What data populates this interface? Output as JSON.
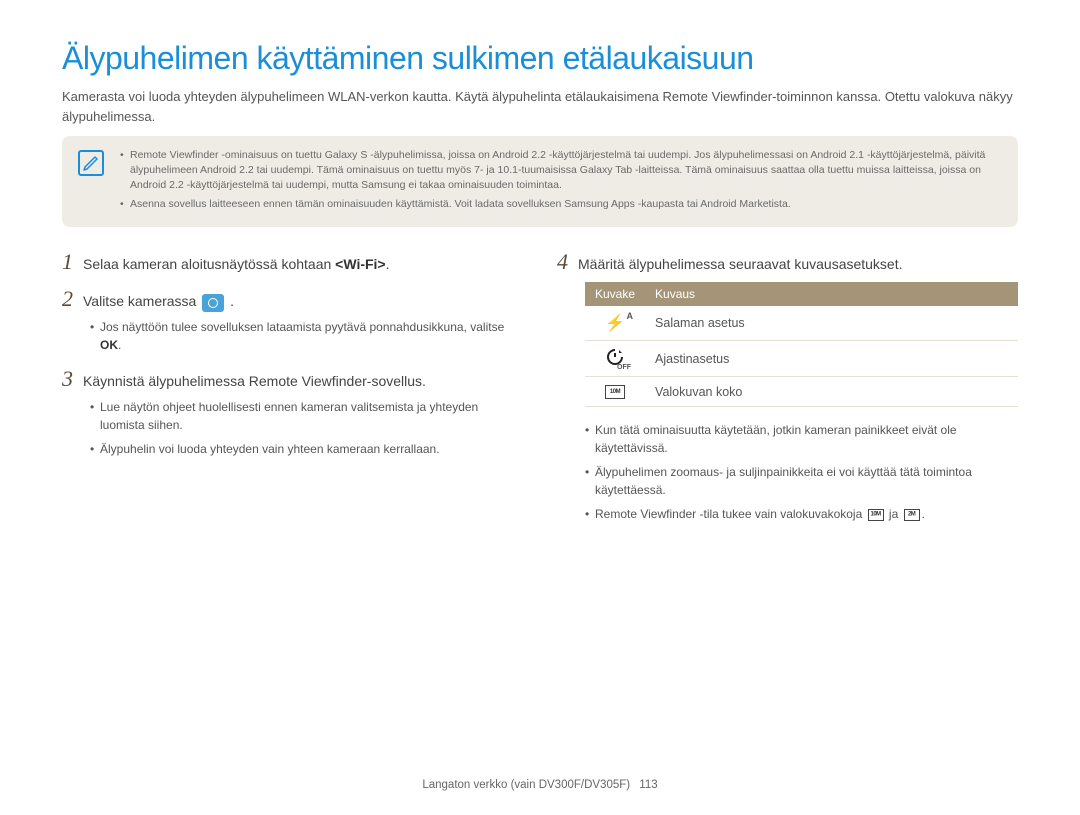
{
  "title": "Älypuhelimen käyttäminen sulkimen etälaukaisuun",
  "intro": "Kamerasta voi luoda yhteyden älypuhelimeen WLAN-verkon kautta. Käytä älypuhelinta etälaukaisimena Remote Viewfinder-toiminnon kanssa. Otettu valokuva näkyy älypuhelimessa.",
  "notes": [
    "Remote Viewfinder -ominaisuus on tuettu Galaxy S -älypuhelimissa, joissa on Android 2.2 -käyttöjärjestelmä tai uudempi. Jos älypuhelimessasi on Android 2.1 -käyttöjärjestelmä, päivitä älypuhelimeen Android 2.2 tai uudempi. Tämä ominaisuus on tuettu myös 7- ja 10.1-tuumaisissa Galaxy Tab -laitteissa. Tämä ominaisuus saattaa olla tuettu muissa laitteissa, joissa on Android 2.2 -käyttöjärjestelmä tai uudempi, mutta Samsung ei takaa ominaisuuden toimintaa.",
    "Asenna sovellus laitteeseen ennen tämän ominaisuuden käyttämistä. Voit ladata sovelluksen Samsung Apps -kaupasta tai Android Marketista."
  ],
  "left": {
    "step1_pre": "Selaa kameran aloitusnäytössä kohtaan ",
    "step1_b": "<Wi-Fi>",
    "step1_post": ".",
    "step2_pre": "Valitse kamerassa ",
    "step2_post": " .",
    "step2_b1": "Jos näyttöön tulee sovelluksen lataamista pyytävä ponnahdusikkuna, valitse ",
    "step2_b1_b": "OK",
    "step2_b1_post": ".",
    "step3": "Käynnistä älypuhelimessa Remote Viewfinder-sovellus.",
    "step3_b1": "Lue näytön ohjeet huolellisesti ennen kameran valitsemista ja yhteyden luomista siihen.",
    "step3_b2": "Älypuhelin voi luoda yhteyden vain yhteen kameraan kerrallaan."
  },
  "right": {
    "step4": "Määritä älypuhelimessa seuraavat kuvausasetukset.",
    "table": {
      "head": [
        "Kuvake",
        "Kuvaus"
      ],
      "rows": [
        {
          "icon": "flash",
          "label": "Salaman asetus"
        },
        {
          "icon": "timer",
          "label": "Ajastinasetus"
        },
        {
          "icon": "size",
          "label": "Valokuvan koko"
        }
      ]
    },
    "b1": "Kun tätä ominaisuutta käytetään, jotkin kameran painikkeet eivät ole käytettävissä.",
    "b2": "Älypuhelimen zoomaus- ja suljinpainikkeita ei voi käyttää tätä toimintoa käytettäessä.",
    "b3_pre": "Remote Viewfinder -tila tukee vain valokuvakokoja ",
    "b3_mid": " ja ",
    "b3_post": "."
  },
  "footer": {
    "chapter": "Langaton verkko (vain DV300F/DV305F)",
    "page": "113"
  }
}
